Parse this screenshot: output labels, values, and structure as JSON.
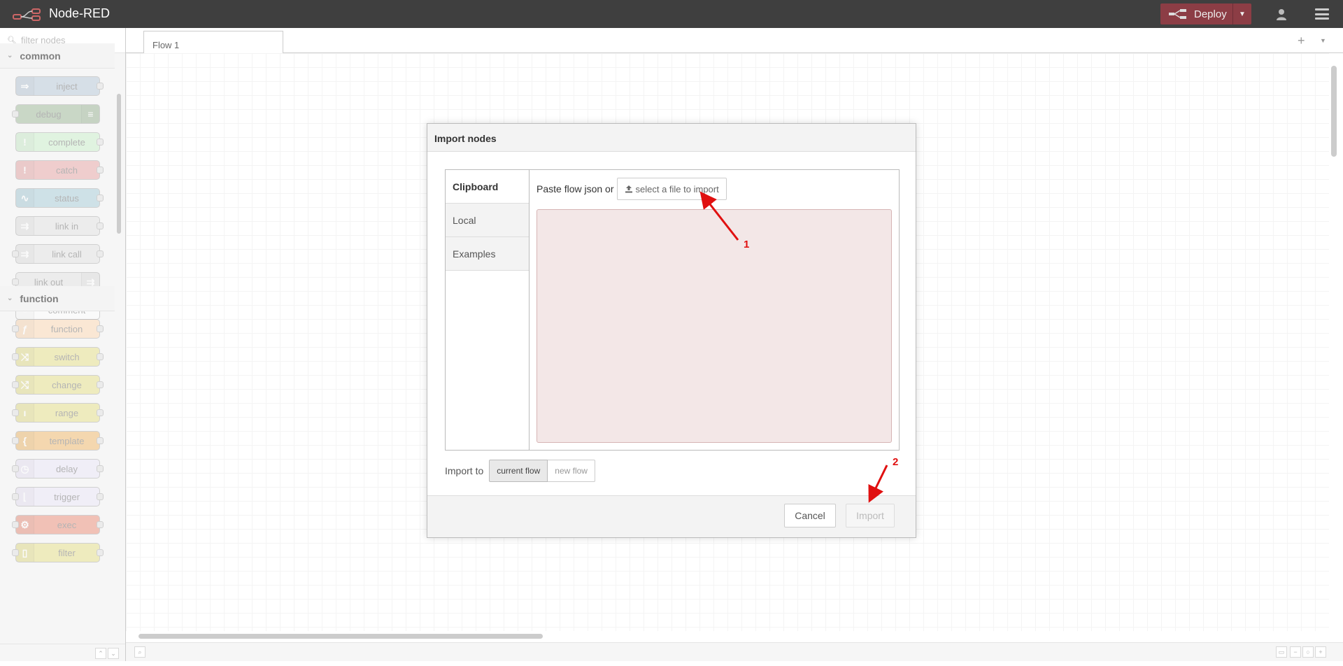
{
  "header": {
    "app_title": "Node-RED",
    "deploy_label": "Deploy",
    "deploy_color": "#8c3d45",
    "header_color": "#3f3f3f"
  },
  "palette": {
    "search_placeholder": "filter nodes",
    "categories": [
      {
        "label": "common",
        "nodes": [
          {
            "label": "inject",
            "color": "#a6bbcf",
            "icon": "arrow-icon"
          },
          {
            "label": "debug",
            "color": "#87a980",
            "icon": "list-icon"
          },
          {
            "label": "complete",
            "color": "#c0edc0",
            "icon": "exclamation-icon"
          },
          {
            "label": "catch",
            "color": "#e49191",
            "icon": "exclamation-icon"
          },
          {
            "label": "status",
            "color": "#94c1d0",
            "icon": "pulse-icon"
          },
          {
            "label": "link in",
            "color": "#dddddd",
            "icon": "link-icon"
          },
          {
            "label": "link call",
            "color": "#dddddd",
            "icon": "link-icon"
          },
          {
            "label": "link out",
            "color": "#dddddd",
            "icon": "link-icon"
          },
          {
            "label": "comment",
            "color": "#ffffff",
            "icon": "comment-icon"
          }
        ]
      },
      {
        "label": "function",
        "nodes": [
          {
            "label": "function",
            "color": "#fdd0a2",
            "icon": "function-icon"
          },
          {
            "label": "switch",
            "color": "#e2d96e",
            "icon": "switch-icon"
          },
          {
            "label": "change",
            "color": "#e2d96e",
            "icon": "shuffle-icon"
          },
          {
            "label": "range",
            "color": "#e2d96e",
            "icon": "range-icon"
          },
          {
            "label": "template",
            "color": "#f0a947",
            "icon": "brace-icon"
          },
          {
            "label": "delay",
            "color": "#e6e0f8",
            "icon": "clock-icon"
          },
          {
            "label": "trigger",
            "color": "#e6e0f8",
            "icon": "trigger-icon"
          },
          {
            "label": "exec",
            "color": "#e8735a",
            "icon": "gear-icon"
          },
          {
            "label": "filter",
            "color": "#e2d96e",
            "icon": "filter-icon"
          }
        ]
      }
    ]
  },
  "workspace": {
    "tabs": [
      {
        "label": "Flow 1"
      }
    ]
  },
  "dialog": {
    "title": "Import nodes",
    "tabs": [
      {
        "label": "Clipboard"
      },
      {
        "label": "Local"
      },
      {
        "label": "Examples"
      }
    ],
    "paste_text": "Paste flow json or",
    "file_button_label": "select a file to import",
    "import_to_label": "Import to",
    "import_to_options": [
      "current flow",
      "new flow"
    ],
    "import_to_selected": "current flow",
    "cancel_label": "Cancel",
    "import_label": "Import"
  },
  "annotations": [
    {
      "label": "1",
      "color": "#e01010"
    },
    {
      "label": "2",
      "color": "#e01010"
    }
  ]
}
